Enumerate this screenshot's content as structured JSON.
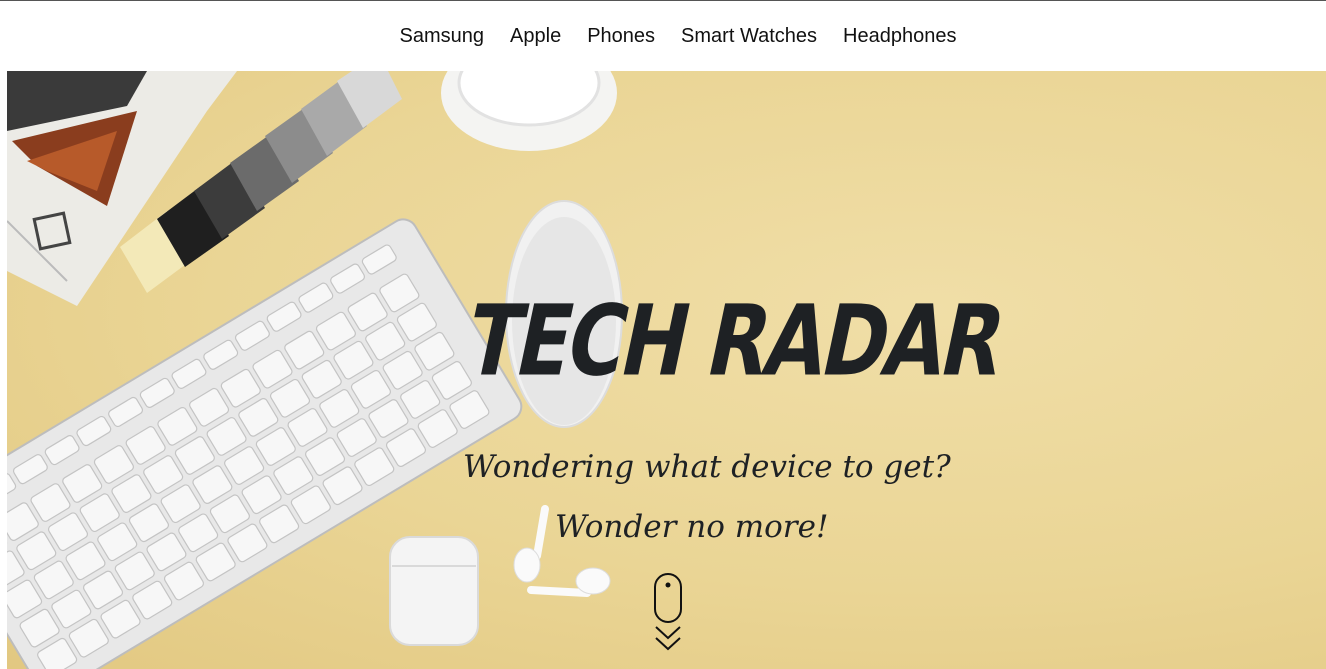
{
  "nav": {
    "items": [
      {
        "label": "Samsung"
      },
      {
        "label": "Apple"
      },
      {
        "label": "Phones"
      },
      {
        "label": "Smart Watches"
      },
      {
        "label": "Headphones"
      }
    ]
  },
  "hero": {
    "title": "TECH RADAR",
    "tagline": "Wondering what device to get?",
    "tagline2": "Wonder no more!",
    "scroll_icon": "mouse-scroll-icon",
    "background_color": "#ead595"
  }
}
